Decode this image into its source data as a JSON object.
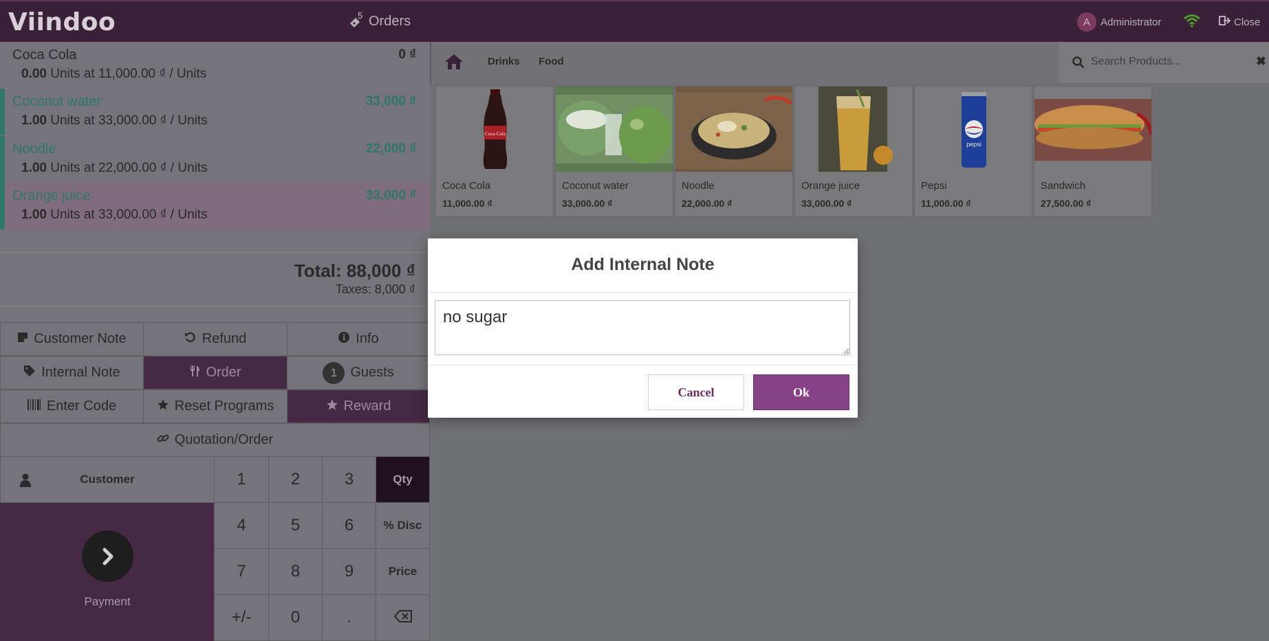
{
  "header": {
    "logo": "Viindoo",
    "orders_label": "Orders",
    "orders_count": "5",
    "user_initial": "A",
    "user_name": "Administrator",
    "close_label": "Close"
  },
  "order_lines": [
    {
      "name": "Coca Cola",
      "price": "0 ₫",
      "qty": "0.00",
      "detail": "Units at 11,000.00 ₫ / Units"
    },
    {
      "name": "Coconut water",
      "price": "33,000 ₫",
      "qty": "1.00",
      "detail": "Units at 33,000.00 ₫ / Units"
    },
    {
      "name": "Noodle",
      "price": "22,000 ₫",
      "qty": "1.00",
      "detail": "Units at 22,000.00 ₫ / Units"
    },
    {
      "name": "Orange juice",
      "price": "33,000 ₫",
      "qty": "1.00",
      "detail": "Units at 33,000.00 ₫ / Units"
    }
  ],
  "summary": {
    "total": "Total: 88,000 ₫",
    "taxes": "Taxes: 8,000 ₫"
  },
  "controls": {
    "customer_note": "Customer Note",
    "refund": "Refund",
    "info": "Info",
    "internal_note": "Internal Note",
    "order": "Order",
    "guests_count": "1",
    "guests": "Guests",
    "enter_code": "Enter Code",
    "reset_programs": "Reset Programs",
    "reward": "Reward",
    "quotation_order": "Quotation/Order"
  },
  "numpad": {
    "customer": "Customer",
    "payment": "Payment",
    "keys": [
      "1",
      "2",
      "3",
      "Qty",
      "4",
      "5",
      "6",
      "% Disc",
      "7",
      "8",
      "9",
      "Price",
      "+/-",
      "0",
      "."
    ]
  },
  "categories": {
    "drinks": "Drinks",
    "food": "Food",
    "search_placeholder": "Search Products..."
  },
  "products": [
    {
      "name": "Coca Cola",
      "price": "11,000.00 ₫"
    },
    {
      "name": "Coconut water",
      "price": "33,000.00 ₫"
    },
    {
      "name": "Noodle",
      "price": "22,000.00 ₫"
    },
    {
      "name": "Orange juice",
      "price": "33,000.00 ₫"
    },
    {
      "name": "Pepsi",
      "price": "11,000.00 ₫"
    },
    {
      "name": "Sandwich",
      "price": "27,500.00 ₫"
    }
  ],
  "dialog": {
    "title": "Add Internal Note",
    "note_value": "no sugar",
    "cancel": "Cancel",
    "ok": "Ok"
  },
  "colors": {
    "brand": "#3b2137",
    "accent": "#874185",
    "green_line": "#2e7865"
  }
}
